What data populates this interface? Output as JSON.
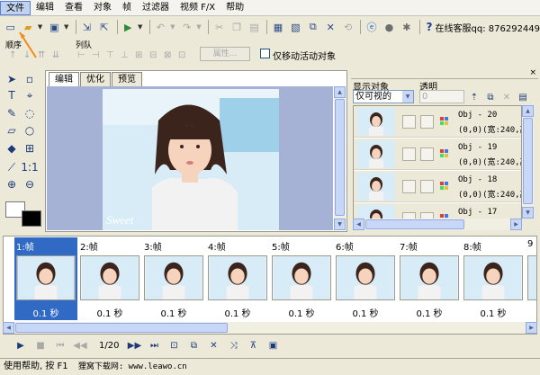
{
  "menu": [
    "文件",
    "编辑",
    "查看",
    "对象",
    "帧",
    "过滤器",
    "视频 F/X",
    "帮助"
  ],
  "toolbar": {
    "online_service": "在线客服qq: 876292449"
  },
  "order": {
    "label_order": "顺序",
    "label_arrange": "列队",
    "property_button": "属性...",
    "move_only_active": "仅移动活动对象"
  },
  "editor": {
    "tabs": [
      "编辑",
      "优化",
      "预览"
    ]
  },
  "objects_panel": {
    "label_display": "显示对象",
    "label_opacity": "透明",
    "display_option": "仅可视的",
    "opacity_value": "0",
    "items": [
      {
        "name": "Obj - 20",
        "pos": "(0,0)(宽:240,高"
      },
      {
        "name": "Obj - 19",
        "pos": "(0,0)(宽:240,高"
      },
      {
        "name": "Obj - 18",
        "pos": "(0,0)(宽:240,高"
      },
      {
        "name": "Obj - 17",
        "pos": ""
      }
    ]
  },
  "frames": [
    {
      "label": "1:帧",
      "delay": "0.1 秒"
    },
    {
      "label": "2:帧",
      "delay": "0.1 秒"
    },
    {
      "label": "3:帧",
      "delay": "0.1 秒"
    },
    {
      "label": "4:帧",
      "delay": "0.1 秒"
    },
    {
      "label": "5:帧",
      "delay": "0.1 秒"
    },
    {
      "label": "6:帧",
      "delay": "0.1 秒"
    },
    {
      "label": "7:帧",
      "delay": "0.1 秒"
    },
    {
      "label": "8:帧",
      "delay": "0.1 秒"
    },
    {
      "label": "9",
      "delay": ""
    }
  ],
  "playback": {
    "counter": "1/20"
  },
  "status": {
    "help_text": "使用帮助, 按 F1",
    "watermark": "狸窝下载网: www.leawo.cn"
  },
  "canvas": {
    "watermark_text": "Sweet"
  }
}
